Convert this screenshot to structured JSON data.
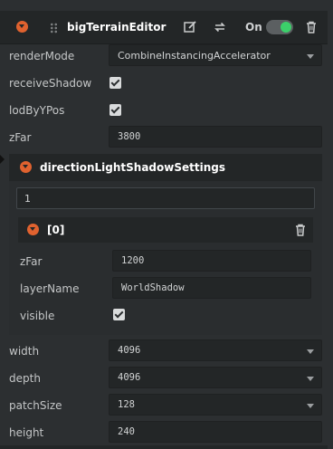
{
  "component": {
    "title": "bigTerrainEditor",
    "toggle_label": "On",
    "toggle_on": true,
    "toggle_color": "#3ccf6a",
    "accent_color": "#e0622f",
    "icons": [
      "edit-icon",
      "reset-icon",
      "trash-icon"
    ]
  },
  "props": {
    "renderMode": {
      "label": "renderMode",
      "value": "CombineInstancingAccelerator"
    },
    "receiveShadow": {
      "label": "receiveShadow",
      "checked": true
    },
    "lodByYPos": {
      "label": "lodByYPos",
      "checked": true
    },
    "zFar": {
      "label": "zFar",
      "value": "3800"
    }
  },
  "shadowSettings": {
    "title": "directionLightShadowSettings",
    "count": "1",
    "item": {
      "title": "[0]",
      "zFar": {
        "label": "zFar",
        "value": "1200"
      },
      "layerName": {
        "label": "layerName",
        "value": "WorldShadow"
      },
      "visible": {
        "label": "visible",
        "checked": true
      }
    }
  },
  "terrain": {
    "width": {
      "label": "width",
      "value": "4096"
    },
    "depth": {
      "label": "depth",
      "value": "4096"
    },
    "patchSize": {
      "label": "patchSize",
      "value": "128"
    },
    "height": {
      "label": "height",
      "value": "240"
    }
  }
}
